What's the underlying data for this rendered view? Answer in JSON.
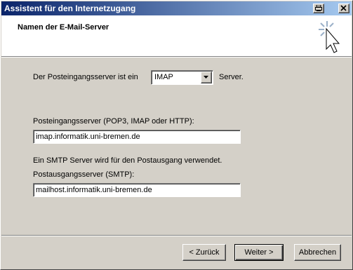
{
  "window": {
    "title": "Assistent für den Internetzugang"
  },
  "header": {
    "title": "Namen der E-Mail-Server",
    "icon": "wizard-wand-icon"
  },
  "form": {
    "incoming_type_prefix": "Der Posteingangsserver ist ein",
    "incoming_type_value": "IMAP",
    "incoming_type_suffix": "Server.",
    "incoming_label": "Posteingangsserver (POP3, IMAP oder HTTP):",
    "incoming_value": "imap.informatik.uni-bremen.de",
    "smtp_note": "Ein SMTP Server wird für den Postausgang verwendet.",
    "outgoing_label": "Postausgangsserver (SMTP):",
    "outgoing_value": "mailhost.informatik.uni-bremen.de"
  },
  "buttons": {
    "back": "< Zurück",
    "next": "Weiter >",
    "cancel": "Abbrechen"
  }
}
